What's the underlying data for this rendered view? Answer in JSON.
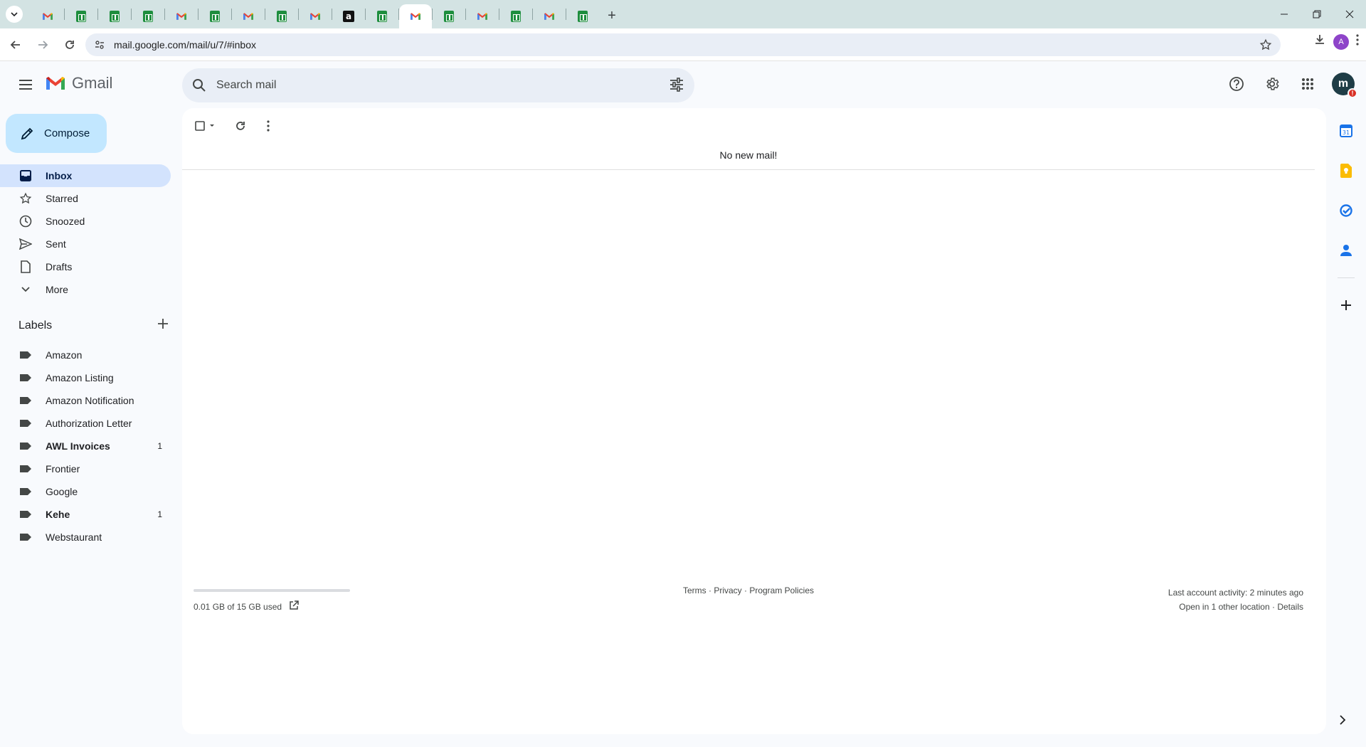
{
  "browser": {
    "url": "mail.google.com/mail/u/7/#inbox",
    "profile_initial": "A",
    "tabs": [
      {
        "icon": "gmail-icon"
      },
      {
        "icon": "sheets-icon"
      },
      {
        "icon": "sheets-icon"
      },
      {
        "icon": "sheets-icon"
      },
      {
        "icon": "gmail-icon"
      },
      {
        "icon": "sheets-icon"
      },
      {
        "icon": "gmail-icon"
      },
      {
        "icon": "sheets-icon"
      },
      {
        "icon": "gmail-icon"
      },
      {
        "icon": "amazon-icon"
      },
      {
        "icon": "sheets-icon"
      },
      {
        "icon": "gmail-icon",
        "active": true
      },
      {
        "icon": "sheets-icon"
      },
      {
        "icon": "gmail-icon"
      },
      {
        "icon": "sheets-icon"
      },
      {
        "icon": "gmail-icon"
      },
      {
        "icon": "sheets-icon"
      }
    ]
  },
  "gmail": {
    "brand": "Gmail",
    "search_placeholder": "Search mail",
    "avatar_initial": "m",
    "compose_label": "Compose",
    "nav": [
      {
        "label": "Inbox",
        "icon": "inbox-icon",
        "active": true
      },
      {
        "label": "Starred",
        "icon": "star-icon"
      },
      {
        "label": "Snoozed",
        "icon": "clock-icon"
      },
      {
        "label": "Sent",
        "icon": "send-icon"
      },
      {
        "label": "Drafts",
        "icon": "draft-icon"
      },
      {
        "label": "More",
        "icon": "chevron-down-icon"
      }
    ],
    "labels_title": "Labels",
    "labels": [
      {
        "label": "Amazon",
        "count": ""
      },
      {
        "label": "Amazon Listing",
        "count": ""
      },
      {
        "label": "Amazon Notification",
        "count": ""
      },
      {
        "label": "Authorization Letter",
        "count": ""
      },
      {
        "label": "AWL Invoices",
        "count": "1",
        "bold": true
      },
      {
        "label": "Frontier",
        "count": ""
      },
      {
        "label": "Google",
        "count": ""
      },
      {
        "label": "Kehe",
        "count": "1",
        "bold": true
      },
      {
        "label": "Webstaurant",
        "count": ""
      }
    ],
    "empty_message": "No new mail!",
    "storage_text": "0.01 GB of 15 GB used",
    "storage_fraction": 0.001,
    "footer_links": "Terms · Privacy · Program Policies",
    "activity_line1": "Last account activity: 2 minutes ago",
    "activity_line2": "Open in 1 other location · Details"
  },
  "colors": {
    "accent": "#0b57d0",
    "compose_bg": "#c2e7ff",
    "active_nav_bg": "#d3e3fd",
    "tabbar_bg": "#d3e3e3"
  }
}
